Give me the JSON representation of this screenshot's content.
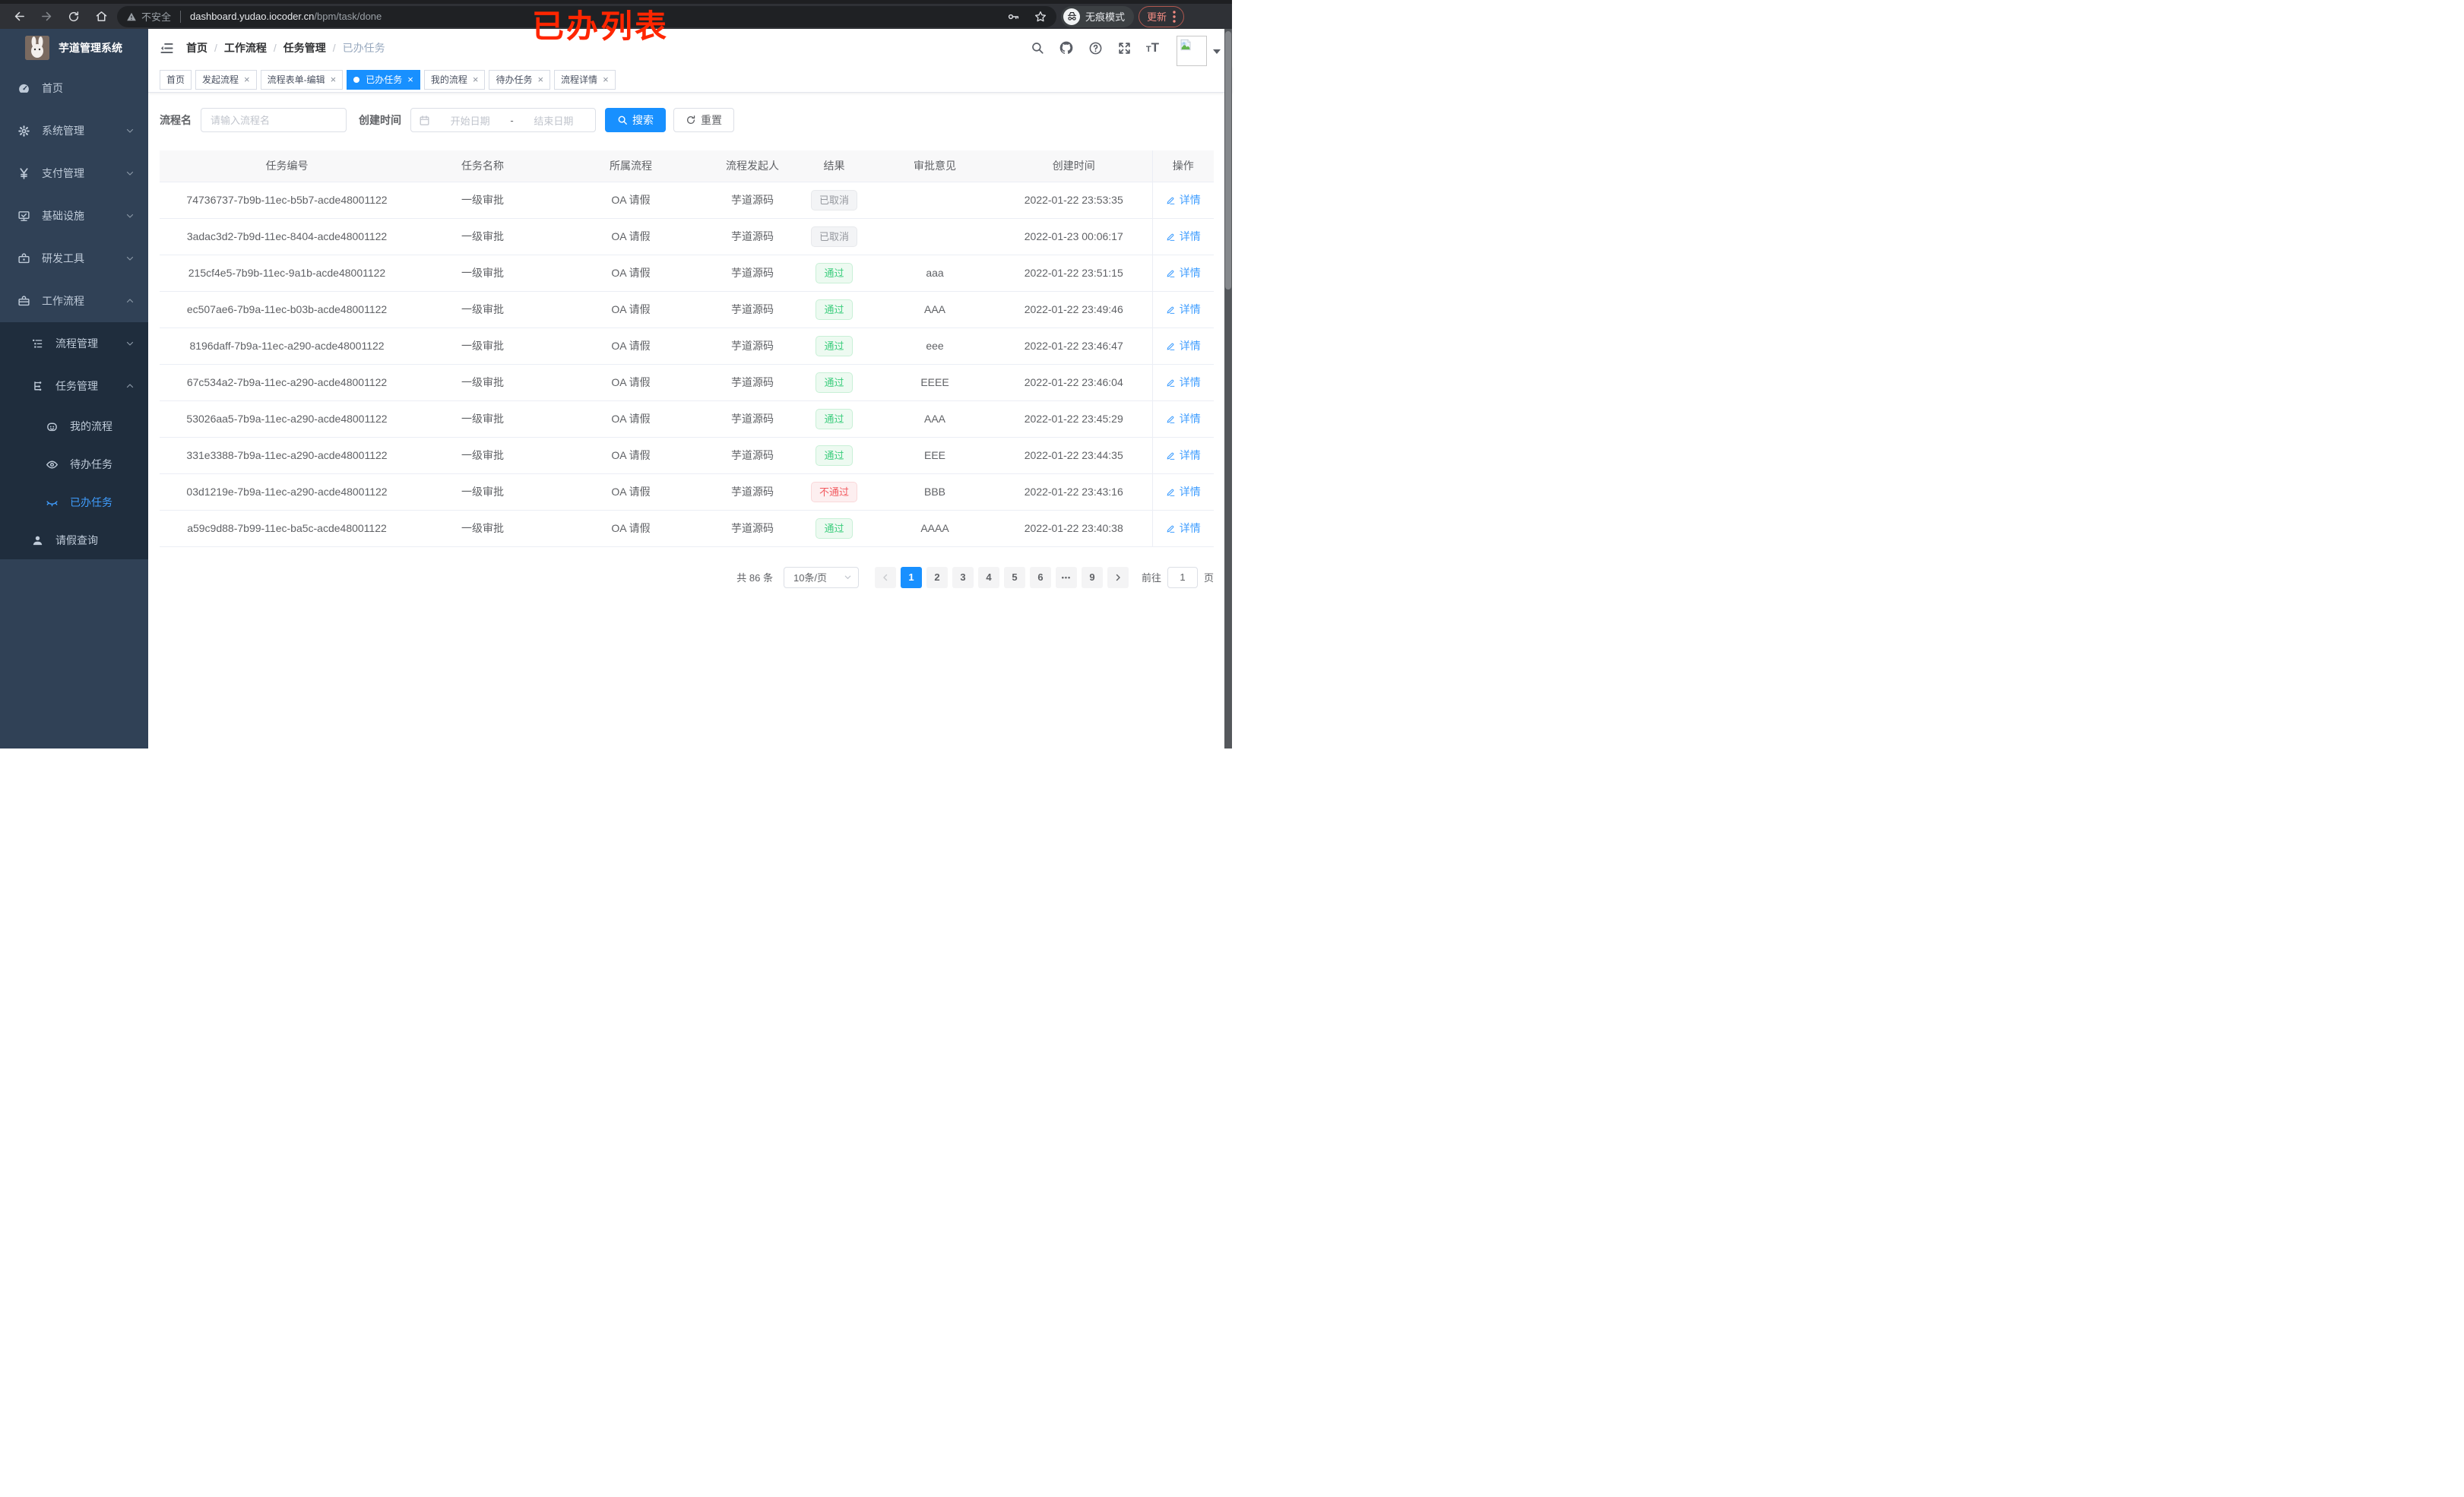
{
  "browser": {
    "security_label": "不安全",
    "url_host": "dashboard.yudao.iocoder.cn",
    "url_path": "/bpm/task/done",
    "incognito_label": "无痕模式",
    "update_label": "更新"
  },
  "annotation": {
    "text": "已办列表",
    "color": "#ff2600"
  },
  "glyphs": {
    "close": "×",
    "more": "•••"
  },
  "colors": {
    "primary": "#1890ff",
    "link": "#409eff",
    "success": "#3ccd7d",
    "danger": "#f25a5f",
    "info": "#95989e",
    "sidebar_bg": "#304156",
    "submenu_bg": "#1f2d3d",
    "active_tab_bg": "#1890ff"
  },
  "sidebar": {
    "title": "芋道管理系统",
    "home": "首页",
    "system": "系统管理",
    "payment": "支付管理",
    "infra": "基础设施",
    "devtools": "研发工具",
    "workflow": "工作流程",
    "process_mgmt": "流程管理",
    "task_mgmt": "任务管理",
    "my_process": "我的流程",
    "todo_task": "待办任务",
    "done_task": "已办任务",
    "leave_query": "请假查询"
  },
  "breadcrumb": {
    "sep": "/",
    "items": [
      "首页",
      "工作流程",
      "任务管理",
      "已办任务"
    ]
  },
  "tabs": [
    {
      "label": "首页"
    },
    {
      "label": "发起流程"
    },
    {
      "label": "流程表单-编辑"
    },
    {
      "label": "已办任务"
    },
    {
      "label": "我的流程"
    },
    {
      "label": "待办任务"
    },
    {
      "label": "流程详情"
    }
  ],
  "filters": {
    "name_label": "流程名",
    "name_placeholder": "请输入流程名",
    "time_label": "创建时间",
    "start_placeholder": "开始日期",
    "range_sep": "-",
    "end_placeholder": "结束日期",
    "search_label": "搜索",
    "reset_label": "重置"
  },
  "table": {
    "headers": [
      "任务编号",
      "任务名称",
      "所属流程",
      "流程发起人",
      "结果",
      "审批意见",
      "创建时间",
      "操作"
    ],
    "detail_label": "详情",
    "rows": [
      {
        "id": "74736737-7b9b-11ec-b5b7-acde48001122",
        "name": "一级审批",
        "process": "OA 请假",
        "starter": "芋道源码",
        "result": "已取消",
        "result_type": "info",
        "comment": "",
        "time": "2022-01-22 23:53:35"
      },
      {
        "id": "3adac3d2-7b9d-11ec-8404-acde48001122",
        "name": "一级审批",
        "process": "OA 请假",
        "starter": "芋道源码",
        "result": "已取消",
        "result_type": "info",
        "comment": "",
        "time": "2022-01-23 00:06:17"
      },
      {
        "id": "215cf4e5-7b9b-11ec-9a1b-acde48001122",
        "name": "一级审批",
        "process": "OA 请假",
        "starter": "芋道源码",
        "result": "通过",
        "result_type": "success",
        "comment": "aaa",
        "time": "2022-01-22 23:51:15"
      },
      {
        "id": "ec507ae6-7b9a-11ec-b03b-acde48001122",
        "name": "一级审批",
        "process": "OA 请假",
        "starter": "芋道源码",
        "result": "通过",
        "result_type": "success",
        "comment": "AAA",
        "time": "2022-01-22 23:49:46"
      },
      {
        "id": "8196daff-7b9a-11ec-a290-acde48001122",
        "name": "一级审批",
        "process": "OA 请假",
        "starter": "芋道源码",
        "result": "通过",
        "result_type": "success",
        "comment": "eee",
        "time": "2022-01-22 23:46:47"
      },
      {
        "id": "67c534a2-7b9a-11ec-a290-acde48001122",
        "name": "一级审批",
        "process": "OA 请假",
        "starter": "芋道源码",
        "result": "通过",
        "result_type": "success",
        "comment": "EEEE",
        "time": "2022-01-22 23:46:04"
      },
      {
        "id": "53026aa5-7b9a-11ec-a290-acde48001122",
        "name": "一级审批",
        "process": "OA 请假",
        "starter": "芋道源码",
        "result": "通过",
        "result_type": "success",
        "comment": "AAA",
        "time": "2022-01-22 23:45:29"
      },
      {
        "id": "331e3388-7b9a-11ec-a290-acde48001122",
        "name": "一级审批",
        "process": "OA 请假",
        "starter": "芋道源码",
        "result": "通过",
        "result_type": "success",
        "comment": "EEE",
        "time": "2022-01-22 23:44:35"
      },
      {
        "id": "03d1219e-7b9a-11ec-a290-acde48001122",
        "name": "一级审批",
        "process": "OA 请假",
        "starter": "芋道源码",
        "result": "不通过",
        "result_type": "danger",
        "comment": "BBB",
        "time": "2022-01-22 23:43:16"
      },
      {
        "id": "a59c9d88-7b99-11ec-ba5c-acde48001122",
        "name": "一级审批",
        "process": "OA 请假",
        "starter": "芋道源码",
        "result": "通过",
        "result_type": "success",
        "comment": "AAAA",
        "time": "2022-01-22 23:40:38"
      }
    ]
  },
  "pagination": {
    "total_label": "共 86 条",
    "page_size_label": "10条/页",
    "pages": [
      "1",
      "2",
      "3",
      "4",
      "5",
      "6"
    ],
    "more": "•••",
    "last_page": "9",
    "goto_label": "前往",
    "goto_value": "1",
    "unit_label": "页"
  }
}
